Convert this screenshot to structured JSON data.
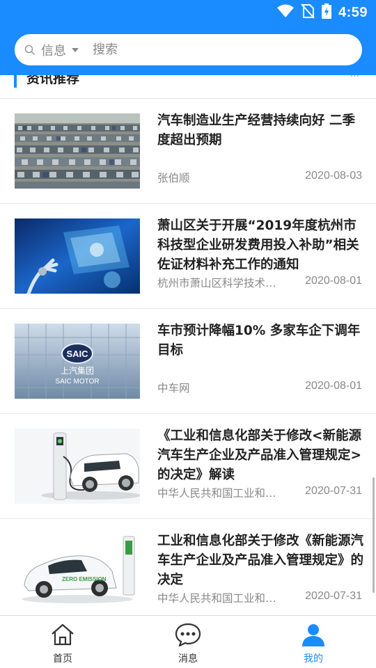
{
  "status_bar": {
    "time": "4:59"
  },
  "search": {
    "category": "信息",
    "placeholder": "搜索"
  },
  "section": {
    "title": "资讯推荐",
    "more": "···"
  },
  "news": [
    {
      "title": "汽车制造业生产经营持续向好 二季度超出预期",
      "source": "张伯顺",
      "date": "2020-08-03"
    },
    {
      "title": "萧山区关于开展“2019年度杭州市科技型企业研发费用投入补助”相关佐证材料补充工作的通知",
      "source": "杭州市萧山区科学技术…",
      "date": "2020-08-01"
    },
    {
      "title": "车市预计降幅10% 多家车企下调年目标",
      "source": "中车网",
      "date": "2020-08-01"
    },
    {
      "title": "《工业和信息化部关于修改<新能源汽车生产企业及产品准入管理规定>的决定》解读",
      "source": "中华人民共和国工业和…",
      "date": "2020-07-31"
    },
    {
      "title": "工业和信息化部关于修改《新能源汽车生产企业及产品准入管理规定》的决定",
      "source": "中华人民共和国工业和…",
      "date": "2020-07-31"
    }
  ],
  "thumbnail_text": {
    "saic_logo": "SAIC",
    "saic_cn": "上汽集团",
    "saic_en": "SAIC MOTOR",
    "zero_emission": "ZERO EMISSION"
  },
  "bottom_nav": [
    {
      "label": "首页",
      "icon": "home-icon"
    },
    {
      "label": "消息",
      "icon": "message-icon"
    },
    {
      "label": "我的",
      "icon": "profile-icon",
      "active": true
    }
  ],
  "colors": {
    "accent": "#1a8cff",
    "text": "#222222",
    "muted": "#888888"
  }
}
